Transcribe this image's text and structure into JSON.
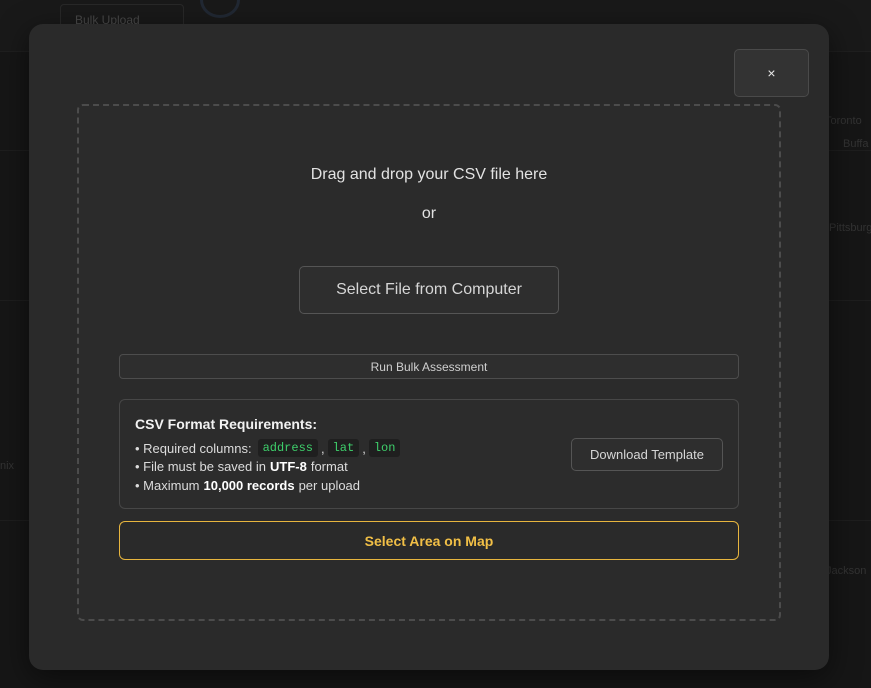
{
  "background": {
    "tab_label": "Bulk Upload",
    "map_labels": [
      "Toronto",
      "Buffa",
      "Pittsburg",
      "Jackson",
      "nix"
    ]
  },
  "modal": {
    "close_label": "×",
    "dropzone": {
      "title": "Drag and drop your CSV file here",
      "or_text": "or",
      "select_file_label": "Select File from Computer"
    },
    "run_label": "Run Bulk Assessment",
    "requirements": {
      "title": "CSV Format Requirements:",
      "line1_prefix": "• Required columns:",
      "columns": [
        "address",
        "lat",
        "lon"
      ],
      "separator": ",",
      "line2_prefix": "• File must be saved in",
      "line2_bold": "UTF-8",
      "line2_suffix": "format",
      "line3_prefix": "• Maximum",
      "line3_bold": "10,000 records",
      "line3_suffix": "per upload",
      "download_label": "Download Template"
    },
    "area_label": "Select Area on Map"
  },
  "colors": {
    "accent": "#f1bf46",
    "code_green": "#3ecf6b"
  }
}
